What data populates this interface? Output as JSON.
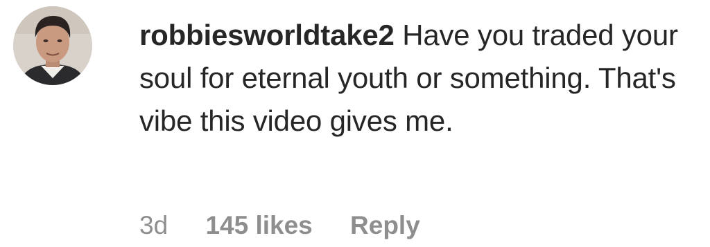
{
  "comment": {
    "username": "robbiesworldtake2",
    "text": "Have you traded your soul for eternal youth or something. That's vibe this video gives me.",
    "timestamp": "3d",
    "likes": "145 likes",
    "reply_label": "Reply",
    "avatar_icon": "user-avatar-photo"
  },
  "colors": {
    "text": "#262626",
    "meta": "#8e8e8e",
    "background": "#ffffff"
  }
}
